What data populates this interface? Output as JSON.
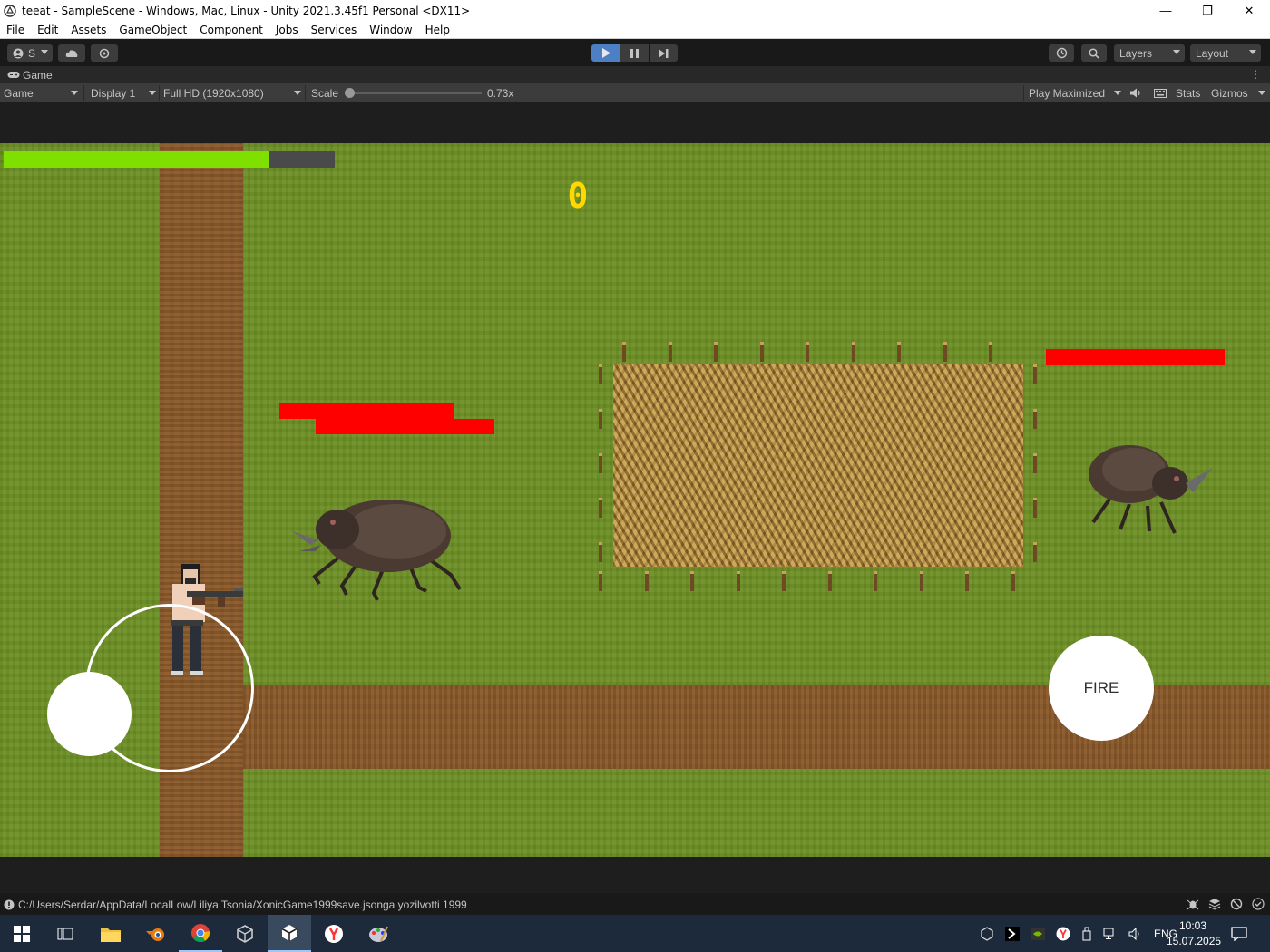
{
  "window": {
    "title": "teeat - SampleScene - Windows, Mac, Linux - Unity 2021.3.45f1 Personal <DX11>",
    "minimize": "—",
    "maximize": "❐",
    "close": "✕"
  },
  "menu": [
    "File",
    "Edit",
    "Assets",
    "GameObject",
    "Component",
    "Jobs",
    "Services",
    "Window",
    "Help"
  ],
  "toolbar": {
    "account_label": "S",
    "layers_label": "Layers",
    "layout_label": "Layout"
  },
  "tab": {
    "label": "Game"
  },
  "game_view": {
    "mode": "Game",
    "display": "Display 1",
    "resolution": "Full HD (1920x1080)",
    "scale_label": "Scale",
    "scale_value": "0.73x",
    "scale_fraction": 0.0,
    "play_maximized": "Play Maximized",
    "stats": "Stats",
    "gizmos": "Gizmos"
  },
  "game": {
    "player_health_fraction": 0.8,
    "score": "0",
    "fire_label": "FIRE"
  },
  "status": {
    "message": "C:/Users/Serdar/AppData/LocalLow/Liliya Tsonia/XonicGame1999save.jsonga yozilvotti 1999"
  },
  "taskbar": {
    "language": "ENG",
    "time": "10:03",
    "date": "15.07.2025"
  },
  "colors": {
    "accent_play": "#4c7fc4",
    "health": "#7fe000",
    "enemy_health": "#ff0000",
    "score": "#ffd800"
  }
}
